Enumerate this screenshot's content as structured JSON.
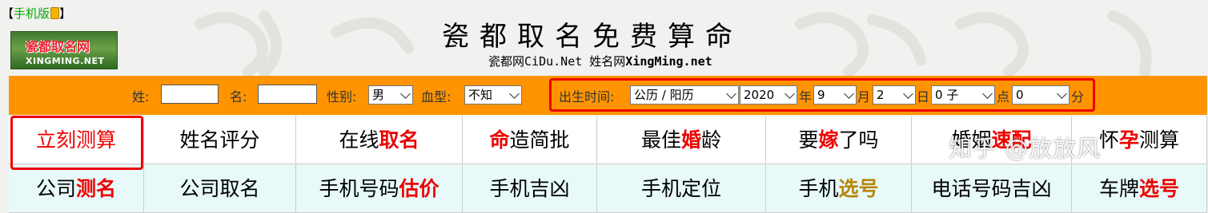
{
  "header": {
    "mobile_link_open": "【",
    "mobile_link": "手机版",
    "mobile_link_close": "】",
    "logo_text": "瓷都取名网",
    "logo_sub": "XINGMING.NET",
    "title": "瓷都取名免费算命",
    "subtitle_part1": "瓷都网",
    "subtitle_part2": "CiDu.Net",
    "subtitle_part3": " 姓名网",
    "subtitle_part4": "XingMing.net"
  },
  "form": {
    "surname_label": "姓:",
    "given_label": "名:",
    "gender_label": "性别:",
    "gender_value": "男",
    "blood_label": "血型:",
    "blood_value": "不知",
    "birth_label": "出生时间:",
    "calendar_value": "公历 / 阳历",
    "year_value": "2020",
    "year_label": "年",
    "month_value": "9",
    "month_label": "月",
    "day_value": "2",
    "day_label": "日",
    "hour_value": "0 子",
    "hour_label": "点",
    "minute_value": "0",
    "minute_label": "分"
  },
  "nav": {
    "row1": [
      {
        "pre": "立刻测算",
        "hl": "",
        "post": ""
      },
      {
        "pre": "姓名评分",
        "hl": "",
        "post": ""
      },
      {
        "pre": "在线",
        "hl": "取名",
        "post": ""
      },
      {
        "pre": "",
        "hl": "命",
        "post": "造简批"
      },
      {
        "pre": "最佳",
        "hl": "婚",
        "post": "龄"
      },
      {
        "pre": "要",
        "hl": "嫁",
        "post": "了吗"
      },
      {
        "pre": "婚姻",
        "hl": "速配",
        "post": ""
      },
      {
        "pre": "怀",
        "hl": "孕",
        "post": "测算"
      }
    ],
    "row2": [
      {
        "pre": "公司",
        "hl": "测名",
        "post": ""
      },
      {
        "pre": "公司取名",
        "hl": "",
        "post": ""
      },
      {
        "pre": "手机号码",
        "hl": "估价",
        "post": ""
      },
      {
        "pre": "手机吉凶",
        "hl": "",
        "post": ""
      },
      {
        "pre": "手机定位",
        "hl": "",
        "post": ""
      },
      {
        "pre": "手机",
        "hl": "选号",
        "post": ""
      },
      {
        "pre": "电话号码吉凶",
        "hl": "",
        "post": ""
      },
      {
        "pre": "车牌",
        "hl": "选号",
        "post": ""
      }
    ]
  },
  "watermark": "知乎 @放放风",
  "colors": {
    "form_bar": "#ff9400",
    "highlight_red": "#e00000",
    "row2_bg": "#e7f9f9"
  }
}
